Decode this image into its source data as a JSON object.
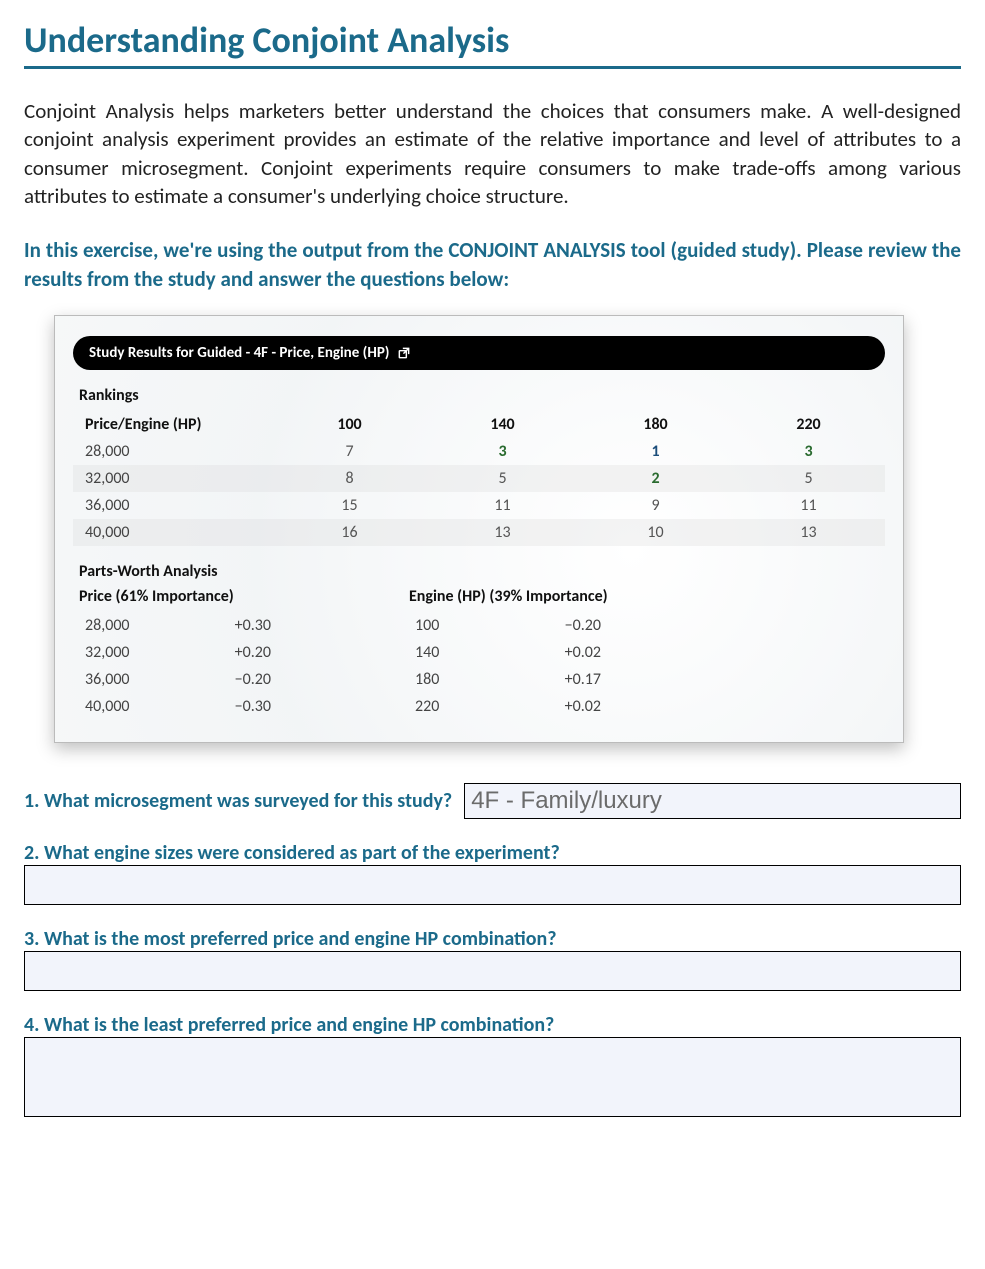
{
  "title": "Understanding Conjoint Analysis",
  "intro": "Conjoint Analysis helps marketers better understand the choices that consumers make.  A well-designed conjoint analysis experiment provides an estimate of the relative importance and level of attributes to a consumer microsegment.   Conjoint experiments require consumers to make trade-offs among various attributes to estimate a consumer's underlying choice structure.",
  "instruction": "In this exercise, we're using the output from the CONJOINT ANALYSIS tool (guided study).  Please review the results from the study and answer the questions below:",
  "study": {
    "bar_title": "Study Results for Guided - 4F - Price, Engine (HP)",
    "rankings": {
      "label": "Rankings",
      "row_header": "Price/Engine (HP)",
      "cols": [
        "100",
        "140",
        "180",
        "220"
      ],
      "rows": [
        {
          "label": "28,000",
          "vals": [
            {
              "v": "7",
              "cls": "val"
            },
            {
              "v": "3",
              "cls": "hot"
            },
            {
              "v": "1",
              "cls": "best"
            },
            {
              "v": "3",
              "cls": "hot"
            }
          ]
        },
        {
          "label": "32,000",
          "vals": [
            {
              "v": "8",
              "cls": "val"
            },
            {
              "v": "5",
              "cls": "val"
            },
            {
              "v": "2",
              "cls": "hot"
            },
            {
              "v": "5",
              "cls": "val"
            }
          ]
        },
        {
          "label": "36,000",
          "vals": [
            {
              "v": "15",
              "cls": "val"
            },
            {
              "v": "11",
              "cls": "val"
            },
            {
              "v": "9",
              "cls": "val"
            },
            {
              "v": "11",
              "cls": "val"
            }
          ]
        },
        {
          "label": "40,000",
          "vals": [
            {
              "v": "16",
              "cls": "val"
            },
            {
              "v": "13",
              "cls": "val"
            },
            {
              "v": "10",
              "cls": "val"
            },
            {
              "v": "13",
              "cls": "val"
            }
          ]
        }
      ]
    },
    "parts_worth": {
      "label": "Parts-Worth Analysis",
      "left": {
        "head": "Price (61% Importance)",
        "rows": [
          {
            "lab": "28,000",
            "num": "+0.30"
          },
          {
            "lab": "32,000",
            "num": "+0.20"
          },
          {
            "lab": "36,000",
            "num": "−0.20"
          },
          {
            "lab": "40,000",
            "num": "−0.30"
          }
        ]
      },
      "right": {
        "head": "Engine (HP) (39% Importance)",
        "rows": [
          {
            "lab": "100",
            "num": "−0.20"
          },
          {
            "lab": "140",
            "num": "+0.02"
          },
          {
            "lab": "180",
            "num": "+0.17"
          },
          {
            "lab": "220",
            "num": "+0.02"
          }
        ]
      }
    }
  },
  "questions": {
    "q1": {
      "text": "1. What microsegment was surveyed for this study?",
      "answer": "4F - Family/luxury"
    },
    "q2": {
      "text": "2. What engine sizes were considered as part of the experiment?",
      "answer": ""
    },
    "q3": {
      "text": "3. What is the most preferred price and engine HP combination?",
      "answer": ""
    },
    "q4": {
      "text": "4. What is the least preferred price and engine HP combination?",
      "answer": ""
    }
  },
  "chart_data": {
    "type": "table",
    "title": "Study Results for Guided - 4F - Price, Engine (HP)",
    "rankings": {
      "row_attribute": "Price",
      "col_attribute": "Engine (HP)",
      "columns": [
        100,
        140,
        180,
        220
      ],
      "rows": [
        {
          "price": 28000,
          "values": [
            7,
            3,
            1,
            3
          ]
        },
        {
          "price": 32000,
          "values": [
            8,
            5,
            2,
            5
          ]
        },
        {
          "price": 36000,
          "values": [
            15,
            11,
            9,
            11
          ]
        },
        {
          "price": 40000,
          "values": [
            16,
            13,
            10,
            13
          ]
        }
      ]
    },
    "parts_worth": {
      "price": {
        "importance_pct": 61,
        "levels": [
          {
            "level": 28000,
            "worth": 0.3
          },
          {
            "level": 32000,
            "worth": 0.2
          },
          {
            "level": 36000,
            "worth": -0.2
          },
          {
            "level": 40000,
            "worth": -0.3
          }
        ]
      },
      "engine_hp": {
        "importance_pct": 39,
        "levels": [
          {
            "level": 100,
            "worth": -0.2
          },
          {
            "level": 140,
            "worth": 0.02
          },
          {
            "level": 180,
            "worth": 0.17
          },
          {
            "level": 220,
            "worth": 0.02
          }
        ]
      }
    }
  }
}
